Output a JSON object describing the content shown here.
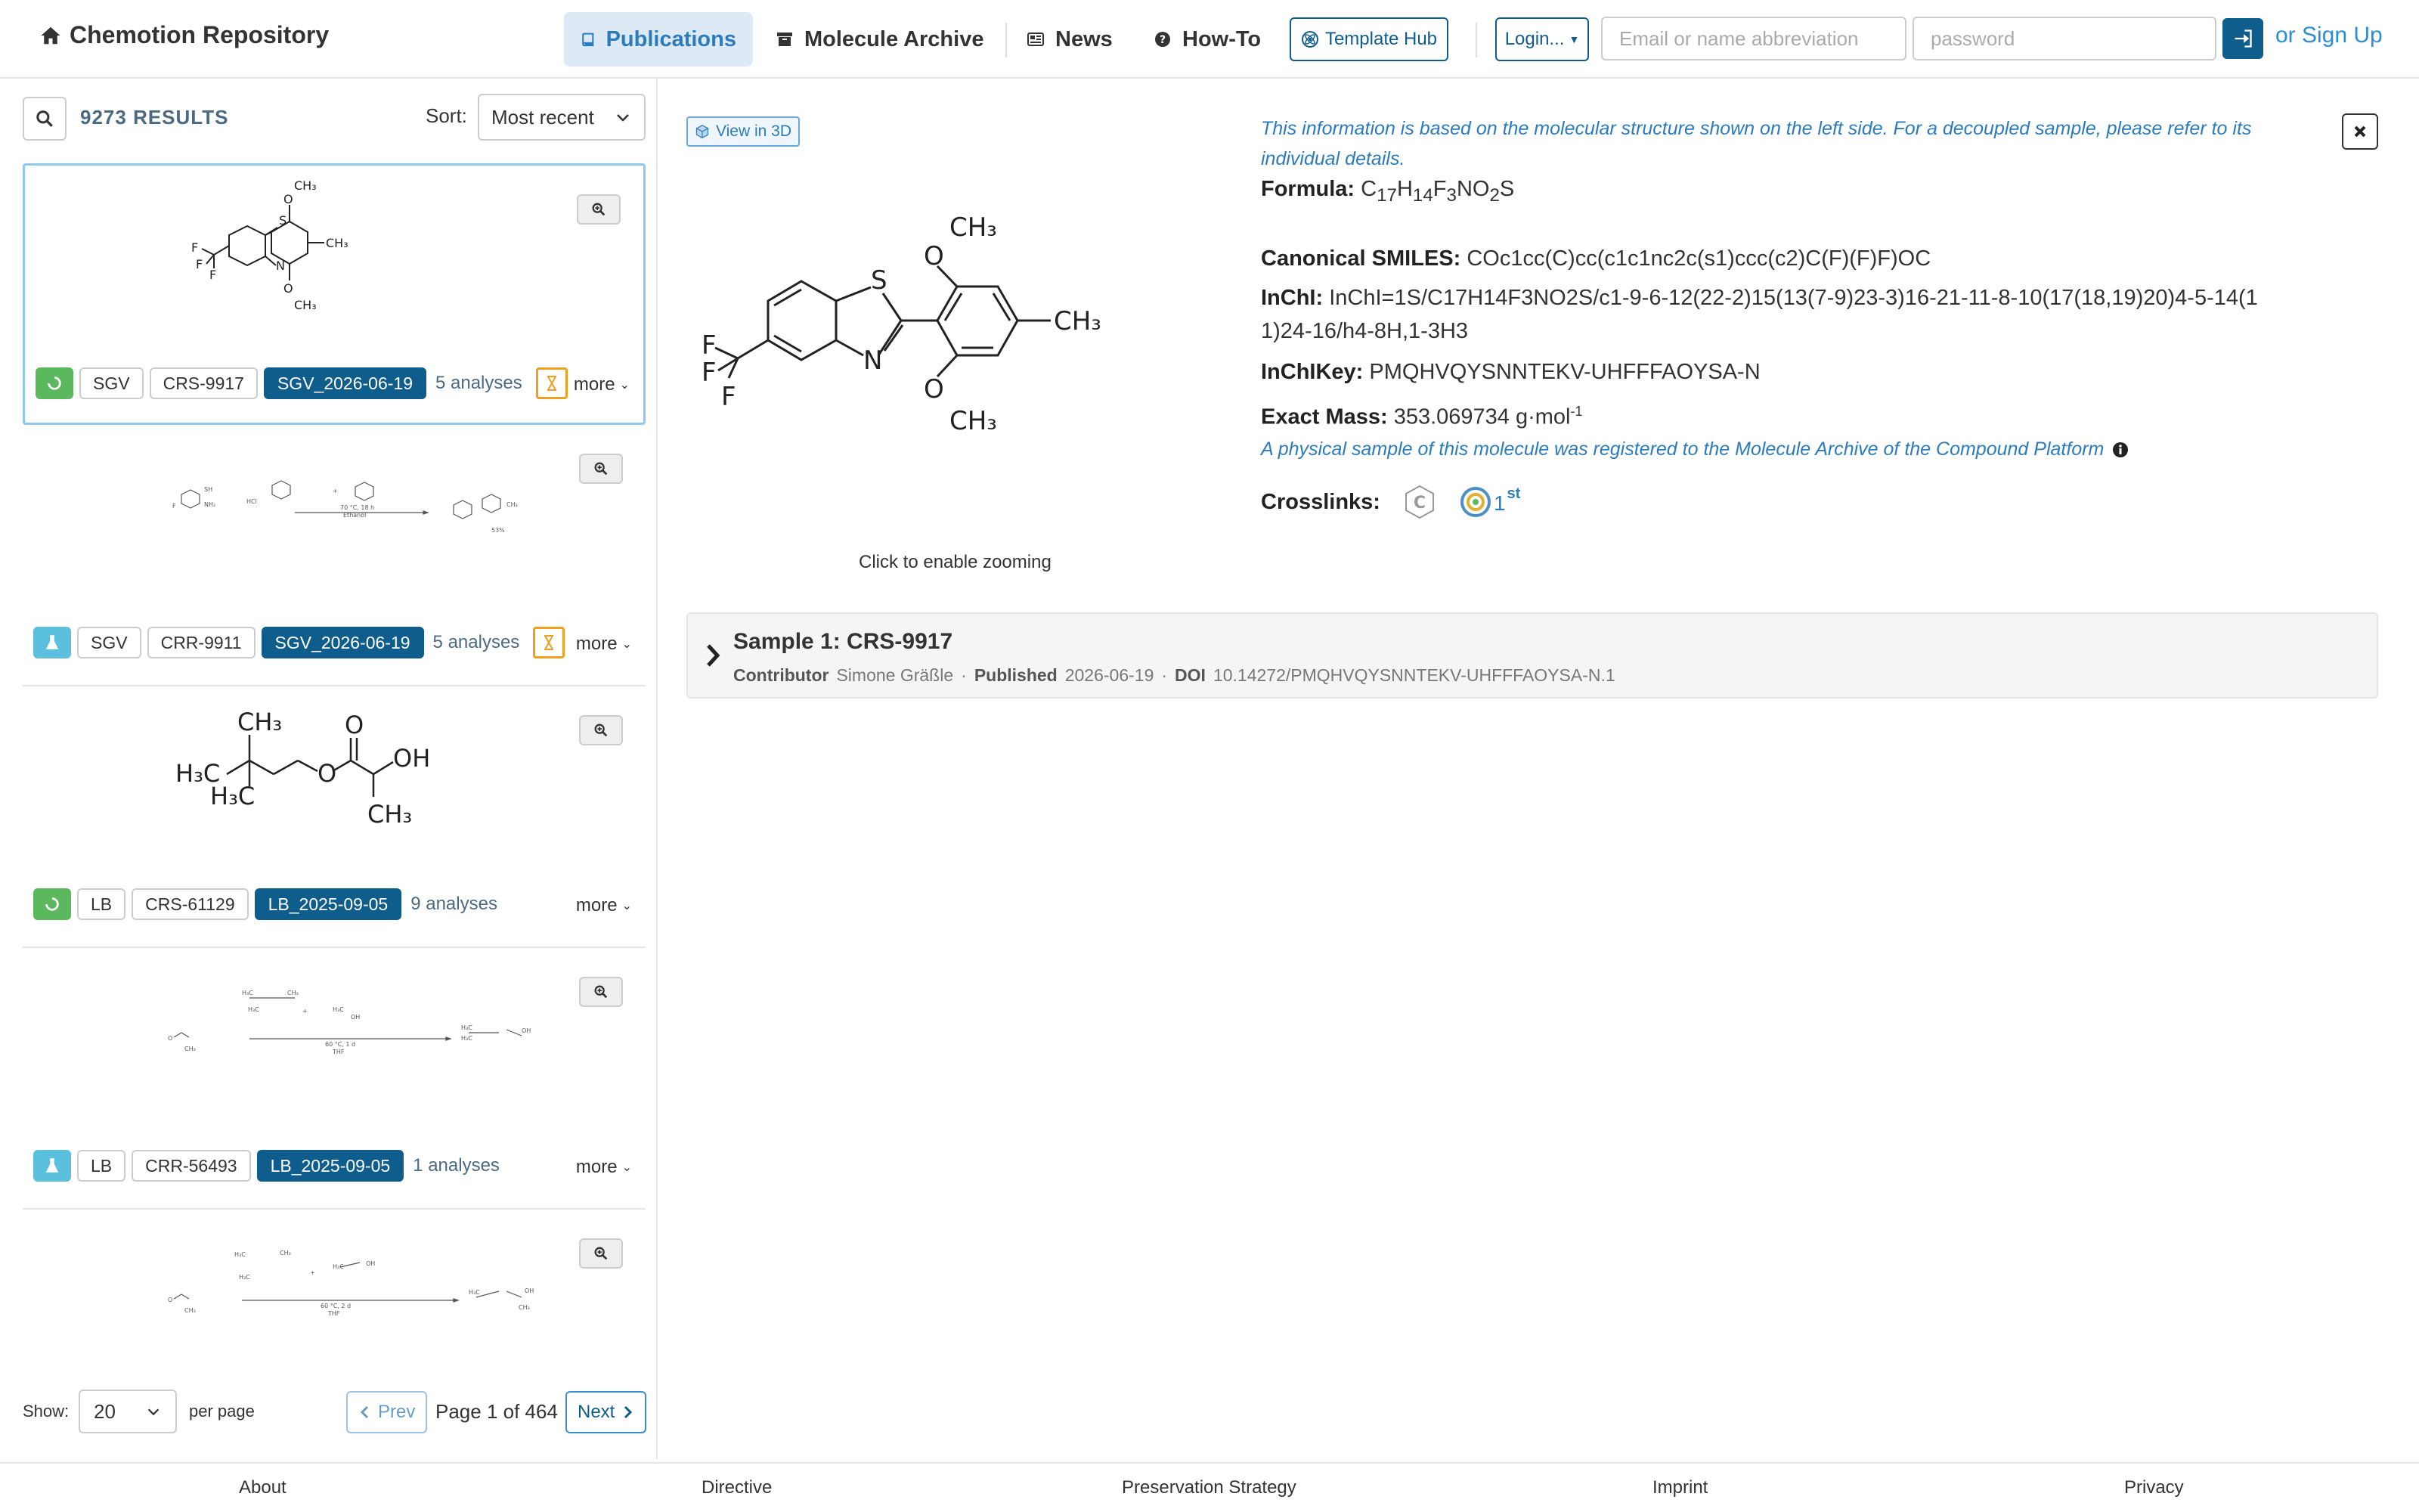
{
  "navbar": {
    "brand": "Chemotion Repository",
    "items": [
      {
        "label": "Publications"
      },
      {
        "label": "Molecule Archive"
      },
      {
        "label": "News"
      },
      {
        "label": "How-To"
      }
    ],
    "template_hub": "Template Hub",
    "login": "Login...",
    "email_placeholder": "Email or name abbreviation",
    "password_placeholder": "password",
    "signup": "or Sign Up"
  },
  "search": {
    "results": "9273 RESULTS",
    "sort_label": "Sort:",
    "sort_value": "Most recent"
  },
  "cards": [
    {
      "status": "green",
      "badges": [
        "SGV",
        "CRS-9917"
      ],
      "dataset": "SGV_2026-06-19",
      "analyses": "5 analyses",
      "pending": true,
      "more": "more"
    },
    {
      "status": "blue",
      "badges": [
        "SGV",
        "CRR-9911"
      ],
      "dataset": "SGV_2026-06-19",
      "analyses": "5 analyses",
      "pending": true,
      "more": "more"
    },
    {
      "status": "green",
      "badges": [
        "LB",
        "CRS-61129"
      ],
      "dataset": "LB_2025-09-05",
      "analyses": "9 analyses",
      "pending": false,
      "more": "more"
    },
    {
      "status": "blue",
      "badges": [
        "LB",
        "CRR-56493"
      ],
      "dataset": "LB_2025-09-05",
      "analyses": "1 analyses",
      "pending": false,
      "more": "more"
    }
  ],
  "pager": {
    "show_label": "Show:",
    "per_page_value": "20",
    "per_page_label": "per page",
    "prev": "Prev",
    "page_info": "Page 1 of 464",
    "next": "Next"
  },
  "detail": {
    "view3d": "View in 3D",
    "zoom_hint": "Click to enable zooming",
    "info_note": "This information is based on the molecular structure shown on the left side. For a decoupled sample, please refer to its individual details.",
    "formula_label": "Formula:",
    "smiles_label": "Canonical SMILES:",
    "smiles": "COc1cc(C)cc(c1c1nc2c(s1)ccc(c2)C(F)(F)F)OC",
    "inchi_label": "InChI:",
    "inchi": "InChI=1S/C17H14F3NO2S/c1-9-6-12(22-2)15(13(7-9)23-3)16-21-11-8-10(17(18,19)20)4-5-14(11)24-16/h4-8H,1-3H3",
    "inchikey_label": "InChIKey:",
    "inchikey": "PMQHVQYSNNTEKV-UHFFFAOYSA-N",
    "mass_label": "Exact Mass:",
    "mass": "353.069734 g·mol",
    "mass_exp": "-1",
    "physical_note": "A physical sample of this molecule was registered to the Molecule Archive of the Compound Platform",
    "crosslinks_label": "Crosslinks:",
    "crosslink_sup": "st",
    "crosslink_num": "1"
  },
  "sample": {
    "title": "Sample 1: CRS-9917",
    "contributor_label": "Contributor",
    "contributor": "Simone Gräßle",
    "published_label": "Published",
    "published": "2026-06-19",
    "doi_label": "DOI",
    "doi": "10.14272/PMQHVQYSNNTEKV-UHFFFAOYSA-N.1"
  },
  "footer": [
    "About",
    "Directive",
    "Preservation Strategy",
    "Imprint",
    "Privacy"
  ],
  "colors": {
    "primary": "#0f5d8c",
    "link": "#2b7bbf",
    "success": "#5cb85c",
    "info": "#5bc0de",
    "warning": "#f0a020"
  }
}
